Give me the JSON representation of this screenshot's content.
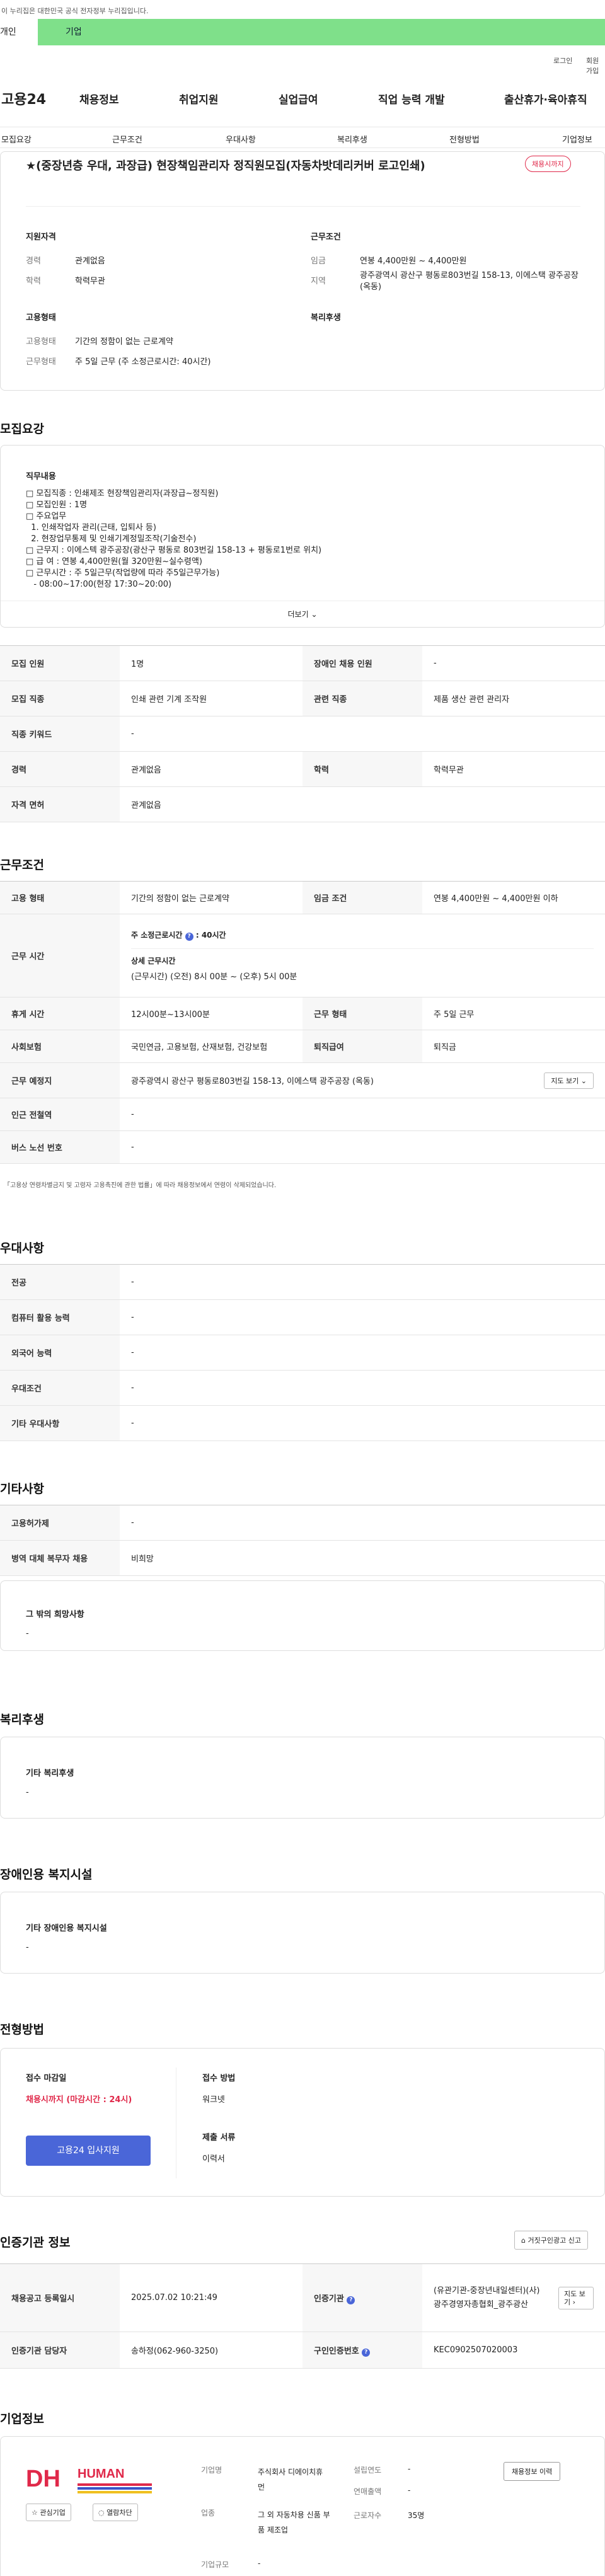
{
  "gov": {
    "notice": "이 누리집은 대한민국 공식 전자정부 누리집입니다.",
    "tab_person": "개인",
    "tab_company": "기업"
  },
  "topbar": {
    "login": "로그인",
    "join": "회원가입"
  },
  "gnb": {
    "logo": "고용24",
    "menu": [
      "채용정보",
      "취업지원",
      "실업급여",
      "직업 능력 개발",
      "출산휴가·육아휴직"
    ]
  },
  "lnb": [
    "모집요강",
    "근무조건",
    "우대사항",
    "복리후생",
    "전형방법",
    "기업정보"
  ],
  "job": {
    "title": "★(중장년층 우대, 과장급) 현장책임관리자 정직원모집(자동차밧데리커버 로고인쇄)",
    "badge": "채용시까지",
    "qual_title": "지원자격",
    "cond_title": "근무조건",
    "career_k": "경력",
    "career_v": "관계없음",
    "edu_k": "학력",
    "edu_v": "학력무관",
    "wage_k": "임금",
    "wage_v": "연봉 4,400만원 ~ 4,400만원",
    "loc_k": "지역",
    "loc_v": "광주광역시 광산구 평동로803번길 158-13, 이에스택 광주공장 (옥동)",
    "emp_title": "고용형태",
    "welfare_title": "복리후생",
    "type_k": "고용형태",
    "type_v": "기간의 정함이 없는 근로계약",
    "hours_k": "근무형태",
    "hours_v": "주 5일 근무 (주 소정근로시간: 40시간)"
  },
  "recruit": {
    "title": "모집요강",
    "duty_title": "직무내용",
    "duty_lines": [
      "□ 모집직종 : 인쇄제조 현장책임관리자(과장급~정직원)",
      "□ 모집인원 : 1명",
      "□ 주요업무",
      "  1. 인쇄작업자 관리(근태, 입퇴사 등)",
      "  2. 현장업무통제 및 인쇄기계정밀조작(기술전수)",
      "□ 근무지 : 이에스텍 광주공장(광산구 평동로 803번길 158-13 + 평동로1번로 위치)",
      "□ 급 여 : 연봉 4,400만원(월 320만원~실수령액)",
      "□ 근무시간 : 주 5일근무(작업량에 따라 주5일근무가능)",
      "   - 08:00~17:00(현장 17:30~20:00)"
    ],
    "more": "더보기",
    "rows": [
      [
        "모집 인원",
        "1명",
        "장애인 채용 인원",
        "-"
      ],
      [
        "모집 직종",
        "인쇄 관련 기계 조작원",
        "관련 직종",
        "제품 생산 관련 관리자"
      ],
      [
        "직종 키워드",
        "-",
        "",
        ""
      ],
      [
        "경력",
        "관계없음",
        "학력",
        "학력무관"
      ],
      [
        "자격 면허",
        "관계없음",
        "",
        ""
      ]
    ]
  },
  "cond": {
    "title": "근무조건",
    "type_k": "고용 형태",
    "type_v": "기간의 정함이 없는 근로계약",
    "wage_k": "임금 조건",
    "wage_v": "연봉 4,400만원 ~ 4,400만원 이하",
    "time_k": "근무 시간",
    "time_week": "주 소정근로시간",
    "time_week_v": "40시간",
    "time_detail_t": "상세 근무시간",
    "time_detail_v": "(근무시간) (오전) 8시 00분 ~ (오후) 5시 00분",
    "rest_k": "휴게 시간",
    "rest_v": "12시00분~13시00분",
    "form_k": "근무 형태",
    "form_v": "주 5일 근무",
    "ins_k": "사회보험",
    "ins_v": "국민연금, 고용보험, 산재보험, 건강보험",
    "ret_k": "퇴직급여",
    "ret_v": "퇴직금",
    "place_k": "근무 예정지",
    "place_v": "광주광역시 광산구 평동로803번길 158-13, 이에스택 광주공장 (옥동)",
    "map": "지도 보기",
    "sub_k": "인근 전철역",
    "sub_v": "-",
    "bus_k": "버스 노선 번호",
    "bus_v": "-",
    "note": "「고용상 연령차별금지 및 고령자 고용촉진에 관한 법률」에 따라 채용정보에서 연령이 삭제되었습니다."
  },
  "pref": {
    "title": "우대사항",
    "rows": [
      [
        "전공",
        "-"
      ],
      [
        "컴퓨터 활용 능력",
        "-"
      ],
      [
        "외국어 능력",
        "-"
      ],
      [
        "우대조건",
        "-"
      ],
      [
        "기타 우대사항",
        "-"
      ]
    ]
  },
  "etc": {
    "title": "기타사항",
    "rows": [
      [
        "고용허가제",
        "-"
      ],
      [
        "병역 대체 복무자 채용",
        "비희망"
      ]
    ],
    "hope_t": "그 밖의 희망사항",
    "hope_v": "-"
  },
  "welfare": {
    "title": "복리후생",
    "box_t": "기타 복리후생",
    "box_v": "-"
  },
  "disab": {
    "title": "장애인용 복지시설",
    "box_t": "기타 장애인용 복지시설",
    "box_v": "-"
  },
  "apply": {
    "title": "전형방법",
    "deadline_t": "접수 마감일",
    "deadline_v": "채용시까지 (마감시간 : 24시)",
    "btn": "고용24 입사지원",
    "method_t": "접수 방법",
    "method_v": "워크넷",
    "doc_t": "제출 서류",
    "doc_v": "이력서"
  },
  "cert": {
    "title": "인증기관 정보",
    "report": "거짓구인광고 신고",
    "reg_k": "채용공고 등록일시",
    "reg_v": "2025.07.02 10:21:49",
    "org_k": "인증기관",
    "org_v": "(유관기관-중장년내일센터)(사)광주경영자총협회_광주광산",
    "map": "지도 보기",
    "mgr_k": "인증기관 담당자",
    "mgr_v": "송하정(062-960-3250)",
    "no_k": "구인인증번호",
    "no_v": "KEC0902507020003"
  },
  "company": {
    "title": "기업정보",
    "logo_a": "DH",
    "logo_b": "HUMAN",
    "interest": "관심기업",
    "block": "열람차단",
    "jobs": "채용정보 이력",
    "ind_k": "기업명",
    "ind_v": "주식회사 디에이치휴먼",
    "biz_k": "업종",
    "biz_v": "그 외 자동차용 신품 부품 제조업",
    "size_k": "기업규모",
    "size_v": "-",
    "year_k": "설립연도",
    "year_v": "-",
    "sales_k": "연매출액",
    "sales_v": "-",
    "emp_k": "근로자수",
    "emp_v": "35명"
  },
  "colors": {
    "green": "#7fe08a",
    "red": "#e0294a",
    "blue": "#4a66d8"
  }
}
